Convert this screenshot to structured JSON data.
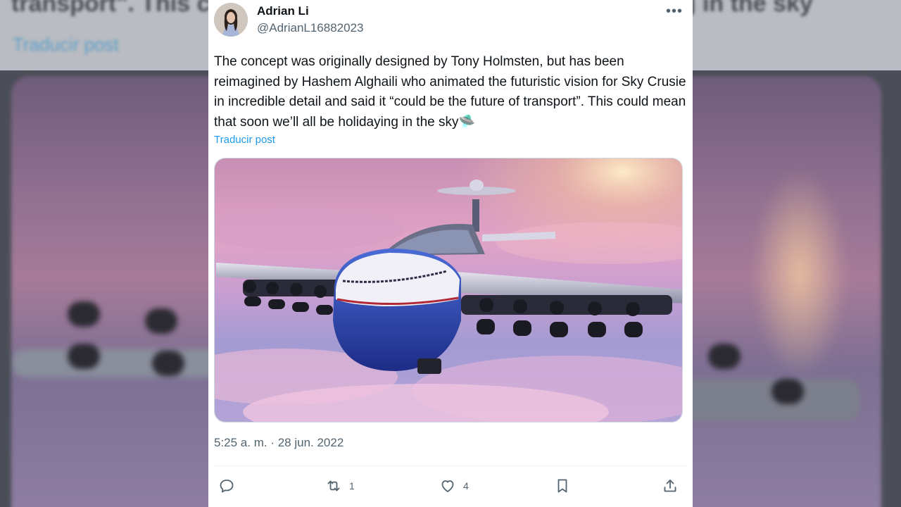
{
  "background": {
    "text_fragment": "transport\". This could mean that soon we'll all be holidaying in the sky",
    "link_fragment": "Traducir post"
  },
  "post": {
    "author_name": "Adrian Li",
    "author_handle": "@AdrianL16882023",
    "text": "The concept was originally designed by Tony Holmsten, but has been reimagined by Hashem Alghaili who animated the futuristic vision for Sky Crusie in incredible detail and said it “could be the future of transport”. This could mean that soon we’ll all be holidaying in the sky🛸",
    "translate_label": "Traducir post",
    "timestamp": "5:25 a. m. · 28 jun. 2022",
    "media_icon": "sky-cruise-plane-image"
  },
  "actions": {
    "reply_icon": "reply-icon",
    "repost_icon": "repost-icon",
    "repost_count": "1",
    "like_icon": "heart-icon",
    "like_count": "4",
    "bookmark_icon": "bookmark-icon",
    "share_icon": "share-icon"
  },
  "colors": {
    "link": "#1d9bf0",
    "text": "#0f1419",
    "muted": "#536471"
  }
}
